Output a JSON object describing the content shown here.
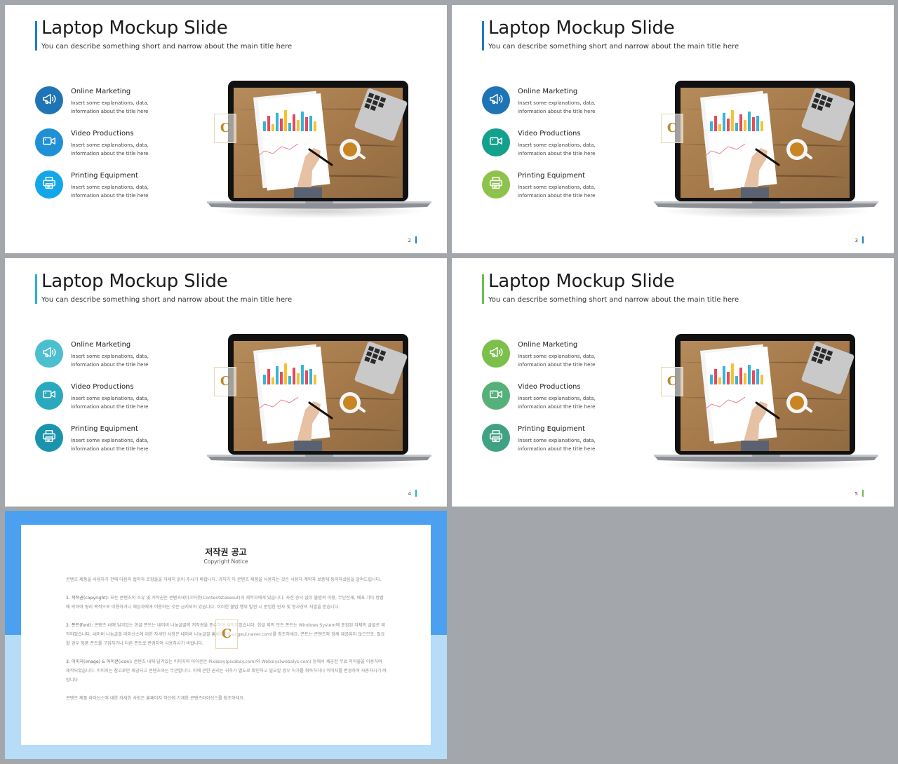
{
  "slides": [
    {
      "title": "Laptop Mockup Slide",
      "subtitle": "You can describe something short and narrow about the main title here",
      "accent": "#1f7dc6",
      "page": "2",
      "items": [
        {
          "title": "Online Marketing",
          "desc": "Insert some explanations, data, information about the title here",
          "icon": "megaphone-icon",
          "color": "#1f74b5"
        },
        {
          "title": "Video Productions",
          "desc": "Insert some explanations, data, information about the title here",
          "icon": "video-camera-icon",
          "color": "#1f8fd6"
        },
        {
          "title": "Printing Equipment",
          "desc": "Insert some explanations, data, information about the title here",
          "icon": "printer-icon",
          "color": "#13a6e8"
        }
      ]
    },
    {
      "title": "Laptop Mockup Slide",
      "subtitle": "You can describe something short and narrow about the main title here",
      "accent": "#1f7dc6",
      "page": "3",
      "items": [
        {
          "title": "Online Marketing",
          "desc": "Insert some explanations, data, information about the title here",
          "icon": "megaphone-icon",
          "color": "#1f74b5"
        },
        {
          "title": "Video Productions",
          "desc": "Insert some explanations, data, information about the title here",
          "icon": "video-camera-icon",
          "color": "#13a08c"
        },
        {
          "title": "Printing Equipment",
          "desc": "Insert some explanations, data, information about the title here",
          "icon": "printer-icon",
          "color": "#8dc24c"
        }
      ]
    },
    {
      "title": "Laptop Mockup Slide",
      "subtitle": "You can describe something short and narrow about the main title here",
      "accent": "#2ab1c9",
      "page": "4",
      "items": [
        {
          "title": "Online Marketing",
          "desc": "Insert some explanations, data, information about the title here",
          "icon": "megaphone-icon",
          "color": "#4cbfcf"
        },
        {
          "title": "Video Productions",
          "desc": "Insert some explanations, data, information about the title here",
          "icon": "video-camera-icon",
          "color": "#2aa9be"
        },
        {
          "title": "Printing Equipment",
          "desc": "Insert some explanations, data, information about the title here",
          "icon": "printer-icon",
          "color": "#1a93ad"
        }
      ]
    },
    {
      "title": "Laptop Mockup Slide",
      "subtitle": "You can describe something short and narrow about the main title here",
      "accent": "#6fbd4f",
      "page": "5",
      "items": [
        {
          "title": "Online Marketing",
          "desc": "Insert some explanations, data, information about the title here",
          "icon": "megaphone-icon",
          "color": "#7cc04b"
        },
        {
          "title": "Video Productions",
          "desc": "Insert some explanations, data, information about the title here",
          "icon": "video-camera-icon",
          "color": "#55b07a"
        },
        {
          "title": "Printing Equipment",
          "desc": "Insert some explanations, data, information about the title here",
          "icon": "printer-icon",
          "color": "#3fa283"
        }
      ]
    }
  ],
  "notice": {
    "title": "저작권 공고",
    "subtitle": "Copyright Notice",
    "intro": "콘텐츠 제품을 사용하기 전에 다음의 협약과 조항들을 자세히 읽어 주시기 바랍니다. 귀하가 이 콘텐츠 제품을 사용하는 것은 사용자 계약과 보증에 동의하셨음을 알려드립니다.",
    "p1_label": "1. 저작권(copyright):",
    "p1": " 모든 콘텐츠의 소유 및 저작권은 콘텐츠테이크아웃(Contentstakeout)과 제작자에게 있습니다. 사전 승낙 없이 불법적 이용, 무단전재, 배포 기타 방법에 의하여 영리 목적으로 이용하거나 제삼자에게 이용하는 것은 금지되어 있습니다. 이러한 불법 행위 발견 시 준엄한 민사 및 형사상의 처벌을 받습니다.",
    "p2_label": "2. 폰트(font):",
    "p2": " 콘텐츠 내에 담겨있는 한글 폰트는 네이버 나눔글꼴의 저작권을 준수하여 제작되었습니다. 한글 외의 모든 폰트는 Windows System에 포함된 자체의 글꼴로 제작되었습니다. 네이버 나눔글꼴 라이선스에 대한 자세한 사항은 네이버 나눔글꼴 홈페이지(hangeul.naver.com)를 참조하세요. 폰트는 콘텐츠와 함께 제공되지 않으므로, 필요할 경우 정품 폰트를 구입하거나 다른 폰트로 변경하여 사용하시기 바랍니다.",
    "p3_label": "3. 이미지(image) & 아이콘(icon):",
    "p3": " 콘텐츠 내에 담겨있는 이미지와 아이콘은 Pixabay(pixabay.com)와 Webalys(webalys.com) 등에서 제공한 무료 저작물을 이용하여 제작되었습니다. 이미지는 참고로만 제공되고 콘텐츠와는 무관합니다. 이에 관한 권리는 귀하가 별도로 확인하고 필요할 경우 허가를 취득하거나 이미지를 변경하여 사용하시기 바랍니다.",
    "outro": "콘텐츠 제품 라이선스에 대한 자세한 사항은 홈페이지 하단에 기재한 콘텐츠라이선스를 참조하세요."
  }
}
